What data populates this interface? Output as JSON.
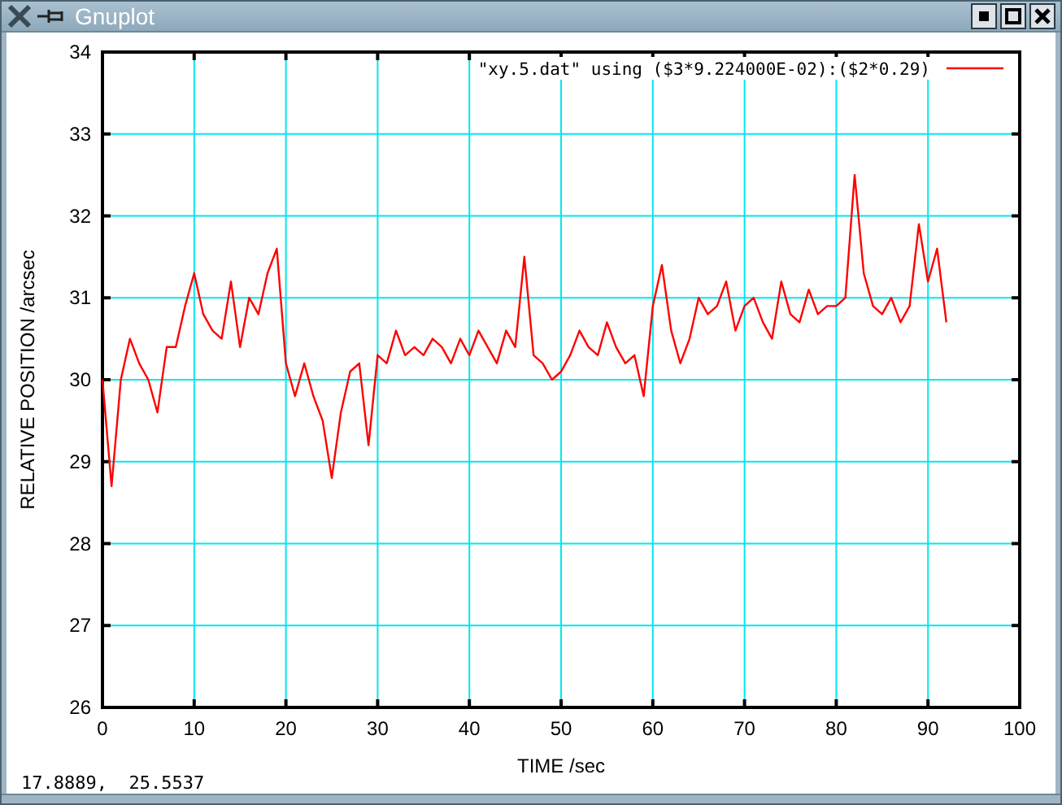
{
  "window": {
    "title": "Gnuplot"
  },
  "plot": {
    "chart_data": {
      "type": "line",
      "xlabel": "TIME /sec",
      "ylabel": "RELATIVE POSITION /arcsec",
      "x": [
        0,
        1,
        2,
        3,
        4,
        5,
        6,
        7,
        8,
        9,
        10,
        11,
        12,
        13,
        14,
        15,
        16,
        17,
        18,
        19,
        20,
        21,
        22,
        23,
        24,
        25,
        26,
        27,
        28,
        29,
        30,
        31,
        32,
        33,
        34,
        35,
        36,
        37,
        38,
        39,
        40,
        41,
        42,
        43,
        44,
        45,
        46,
        47,
        48,
        49,
        50,
        51,
        52,
        53,
        54,
        55,
        56,
        57,
        58,
        59,
        60,
        61,
        62,
        63,
        64,
        65,
        66,
        67,
        68,
        69,
        70,
        71,
        72,
        73,
        74,
        75,
        76,
        77,
        78,
        79,
        80,
        81,
        82,
        83,
        84,
        85,
        86,
        87,
        88,
        89,
        90,
        91,
        92
      ],
      "series": [
        {
          "name": "\"xy.5.dat\" using ($3*9.224000E-02):($2*0.29)",
          "color": "#ff0000",
          "values": [
            30.0,
            28.7,
            30.0,
            30.5,
            30.2,
            30.0,
            29.6,
            30.4,
            30.4,
            30.9,
            31.3,
            30.8,
            30.6,
            30.5,
            31.2,
            30.4,
            31.0,
            30.8,
            31.3,
            31.6,
            30.2,
            29.8,
            30.2,
            29.8,
            29.5,
            28.8,
            29.6,
            30.1,
            30.2,
            29.2,
            30.3,
            30.2,
            30.6,
            30.3,
            30.4,
            30.3,
            30.5,
            30.4,
            30.2,
            30.5,
            30.3,
            30.6,
            30.4,
            30.2,
            30.6,
            30.4,
            31.5,
            30.3,
            30.2,
            30.0,
            30.1,
            30.3,
            30.6,
            30.4,
            30.3,
            30.7,
            30.4,
            30.2,
            30.3,
            29.8,
            30.9,
            31.4,
            30.6,
            30.2,
            30.5,
            31.0,
            30.8,
            30.9,
            31.2,
            30.6,
            30.9,
            31.0,
            30.7,
            30.5,
            31.2,
            30.8,
            30.7,
            31.1,
            30.8,
            30.9,
            30.9,
            31.0,
            32.5,
            31.3,
            30.9,
            30.8,
            31.0,
            30.7,
            30.9,
            31.9,
            31.2,
            31.6,
            30.7
          ]
        }
      ],
      "grid": true,
      "xlim": [
        0,
        100
      ],
      "ylim": [
        26,
        34
      ],
      "xticks": [
        0,
        10,
        20,
        30,
        40,
        50,
        60,
        70,
        80,
        90,
        100
      ],
      "yticks": [
        26,
        27,
        28,
        29,
        30,
        31,
        32,
        33,
        34
      ]
    }
  },
  "status_bar": {
    "coordinates": "17.8889,  25.5537"
  }
}
